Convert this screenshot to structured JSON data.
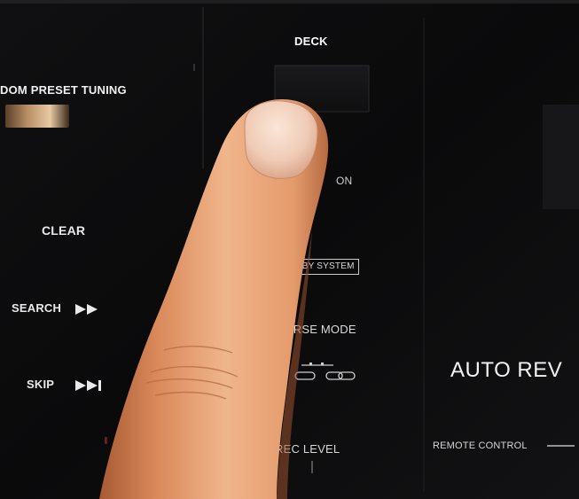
{
  "panel": {
    "preset_tuning_label": "DOM PRESET TUNING",
    "deck_label": "DECK",
    "on_label": "ON",
    "clear_label": "CLEAR",
    "search_label": "SEARCH",
    "skip_label": "SKIP",
    "dolby_label": "OLBY SYSTEM",
    "reverse_mode_label": "VERSE MODE",
    "auto_reverse_label": "AUTO REV",
    "remote_control_label": "REMOTE CONTROL",
    "rec_level_label": "REC LEVEL"
  },
  "icons": {
    "search": "fast-forward-icon",
    "skip": "skip-forward-icon",
    "reverse_mode": "reverse-mode-symbols-icon"
  },
  "colors": {
    "panel": "#0c0c0d",
    "label": "#e9e9ea",
    "finger": "#e8a47a",
    "tuning_knob": "#c9a27a"
  }
}
